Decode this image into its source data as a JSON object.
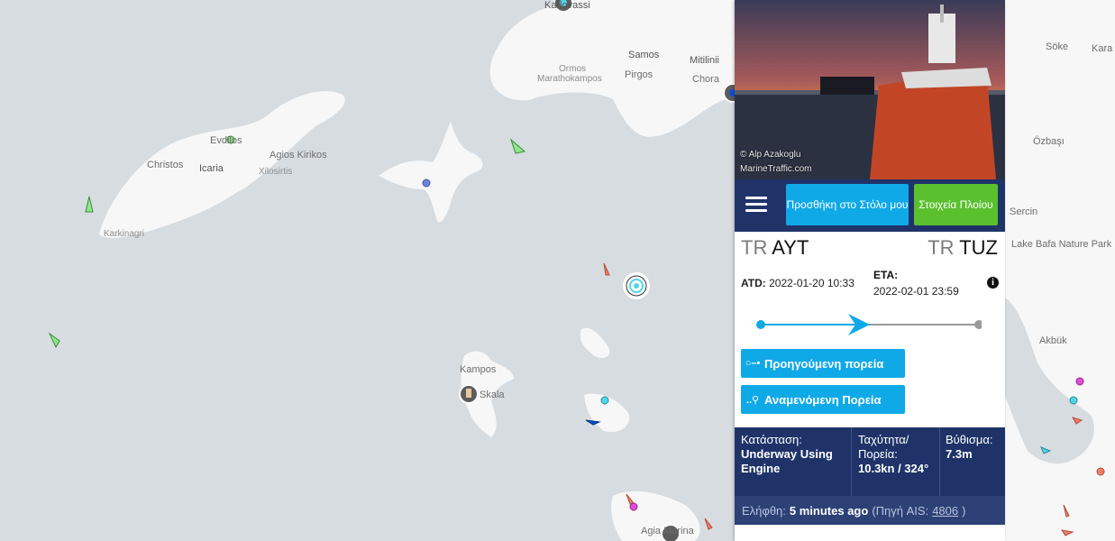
{
  "map": {
    "labels": {
      "karlovassi": "Karlovassi",
      "samos": "Samos",
      "mitilinii": "Mitilinii",
      "ormos": "Ormos",
      "marathokampos": "Marathokampos",
      "pirgos": "Pirgos",
      "chora": "Chora",
      "evdilos": "Evdilos",
      "christos": "Christos",
      "icaria": "Icaria",
      "agios_kirikos": "Agios Kirikos",
      "xylosirtis": "Xilosirtis",
      "karkinagri": "Karkinagri",
      "kampos": "Kampos",
      "skala": "Skala",
      "agia_marina": "Agia Marina",
      "soke": "Söke",
      "kara": "Kara",
      "ozbasi": "Özbaşı",
      "sercin": "Sercin",
      "lake_bafa": "Lake Bafa Nature Park",
      "akbuk": "Akbük"
    },
    "colors": {
      "sea": "#d7dce0",
      "land": "#f7f7f7",
      "cargo": "#8fe887",
      "tanker": "#ee7f6a",
      "passenger": "#0f4fd6",
      "tug": "#4fd6e8"
    }
  },
  "panel": {
    "photo_credit_1": "© Alp Azakoglu",
    "photo_credit_2": "MarineTraffic.com",
    "add_fleet": "Προσθήκη στο Στόλο μου",
    "vessel_info": "Στοιχεία Πλοίου",
    "departure": {
      "country": "TR",
      "code": "AYT"
    },
    "arrival": {
      "country": "TR",
      "code": "TUZ"
    },
    "atd_label": "ATD:",
    "atd_value": "2022-01-20 10:33",
    "eta_label": "ETA:",
    "eta_value": "2022-02-01 23:59",
    "info_icon": "i",
    "progress": 0.5,
    "past_track": "Προηγούμενη πορεία",
    "forecast_track": "Αναμενόμενη Πορεία",
    "status_label": "Κατάσταση:",
    "status_value": "Underway Using Engine",
    "speed_label": "Ταχύτητα/ Πορεία:",
    "speed_value": "10.3kn / 324°",
    "draught_label": "Βύθισμα:",
    "draught_value": "7.3m",
    "received_label": "Ελήφθη:",
    "received_value": "5 minutes ago",
    "source_label": "(Πηγή AIS:",
    "source_id": "4806",
    "source_end": ")"
  }
}
